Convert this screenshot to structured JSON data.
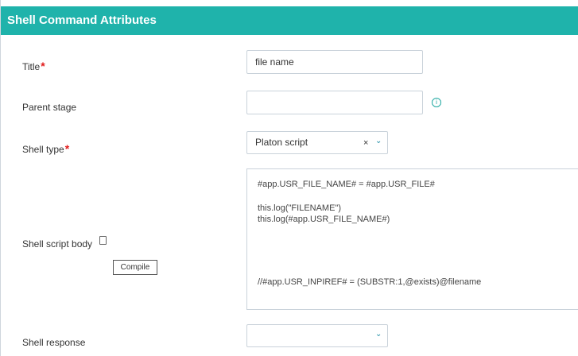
{
  "header": {
    "title": "Shell Command Attributes"
  },
  "fields": {
    "title": {
      "label": "Title",
      "value": "file name"
    },
    "parent_stage": {
      "label": "Parent stage",
      "value": ""
    },
    "shell_type": {
      "label": "Shell type",
      "value": "Platon script"
    },
    "shell_script_body": {
      "label": "Shell script body",
      "compile_label": "Compile",
      "lines": [
        "#app.USR_FILE_NAME# = #app.USR_FILE#",
        "this.log(\"FILENAME\")",
        "this.log(#app.USR_FILE_NAME#)",
        "//#app.USR_INPIREF# = (SUBSTR:1,@exists)@filename"
      ]
    },
    "shell_response": {
      "label": "Shell response",
      "value": ""
    }
  },
  "icons": {
    "required": "*",
    "info": "i",
    "clear": "×",
    "chevron": "⌄"
  },
  "colors": {
    "header_bg": "#1fb3ab",
    "required": "#e11b1b",
    "accent": "#1fa7a0"
  }
}
